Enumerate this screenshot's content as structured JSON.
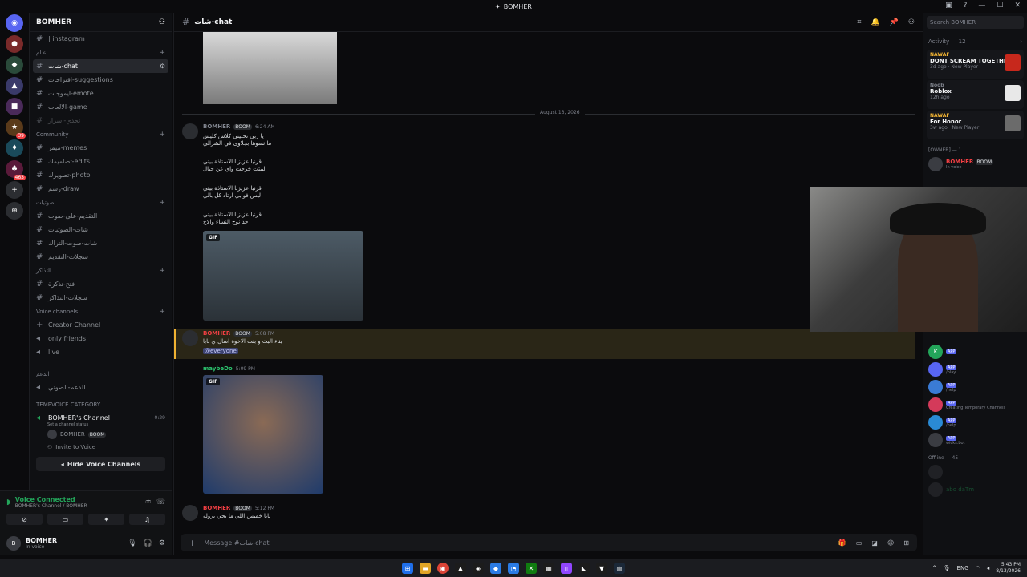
{
  "window": {
    "title": "BOMHER"
  },
  "servers": [
    {
      "icon": "discord-icon",
      "badge": ""
    },
    {
      "icon": "server-icon",
      "badge": ""
    },
    {
      "icon": "server-icon",
      "badge": ""
    },
    {
      "icon": "server-icon",
      "badge": ""
    },
    {
      "icon": "server-icon",
      "badge": ""
    },
    {
      "icon": "server-icon",
      "badge": "39"
    },
    {
      "icon": "server-icon",
      "badge": ""
    },
    {
      "icon": "server-icon",
      "badge": "463"
    }
  ],
  "server": {
    "name": "BOMHER"
  },
  "channels": {
    "instagram": "| instagram",
    "cat_general": "عـام",
    "chat": "شات-chat",
    "suggestions": "اقتراحات-suggestions",
    "emote": "ايموجات-emote",
    "game": "الالعاب-game",
    "hidden1": "تحدي-اسرار",
    "cat_community": "Community",
    "memes": "ميمز-memes",
    "edits": "تصاميمك-edits",
    "photo": "تصويرك-photo",
    "draw": "رسم-draw",
    "cat_voice_ar": "صوتيات",
    "v_ar1": "التقديم-على-صوت",
    "v_ar2": "شات-الصوتيات",
    "v_ar3": "شات-صوت-التراك",
    "v_ar4": "سجلات-التقديم",
    "cat_tickets": "التذاكر",
    "t1": "فتح-تذكرة",
    "t2": "سجلات-التذاكر",
    "cat_voice": "Voice channels",
    "creator": "Creator Channel",
    "only_friends": "only friends",
    "live": "live",
    "cat_support": "الدعم",
    "support_voice": "الدعم-الصوتي",
    "cat_temp": "TEMPVOICE CATEGORY",
    "bomher_channel": "BOMHER's Channel",
    "bomher_channel_time": "0:29",
    "channel_status": "Set a channel status",
    "voice_user": "BOMHER",
    "voice_user_tag": "BOOM",
    "invite": "Invite to Voice",
    "hide_btn": "Hide Voice Channels"
  },
  "voice": {
    "status": "Voice Connected",
    "location": "BOMHER's Channel / BOMHER"
  },
  "user": {
    "name": "BOMHER",
    "status": "In voice"
  },
  "chat": {
    "channel": "شات-chat",
    "date_divider": "August 13, 2026",
    "msg1": {
      "author": "BOMHER",
      "tag": "BOOM",
      "time": "6:24 AM",
      "lines": [
        "يا ربي تخليني كلاش كليش",
        "ما نسوها بجلاوى في الشرالي",
        "قرنيا عزيزنا الاستاذة بيتي",
        "ليبتت خرحت واي عن جبال",
        "قرنيا عزيزنا الاستاذة بيتي",
        "ليس فوابي ارتاد كل بالي",
        "قرنيا عزيزنا الاستاذة بيتي",
        "جذ نوح النساء والاخ"
      ]
    },
    "gif_label": "GIF",
    "msg2": {
      "author": "BOMHER",
      "tag": "BOOM",
      "time": "5:08 PM",
      "text": "بناء البث و بنت الاخوة اسال ي بابا",
      "mention": "@everyone"
    },
    "msg3": {
      "author": "maybeDo",
      "time": "5:09 PM"
    },
    "msg4": {
      "author": "BOMHER",
      "tag": "BOOM",
      "time": "5:12 PM",
      "text": "بابا خميس اللي ما يجي يروله"
    },
    "input_placeholder": "Message #شات-chat"
  },
  "members": {
    "search_placeholder": "Search BOMHER",
    "activity_title": "Activity — 12",
    "activities": [
      {
        "who": "NAWAF",
        "game": "DONT SCREAM TOGETHER",
        "meta": "3d ago · New Player",
        "color": "#c7281c"
      },
      {
        "who": "Noob",
        "game": "Roblox",
        "meta": "12h ago",
        "color": "#e8e8e8"
      },
      {
        "who": "NAWAF",
        "game": "For Honor",
        "meta": "3w ago · New Player",
        "color": "#6b6b6b"
      }
    ],
    "owner_role": "[OWNER] — 1",
    "owner": {
      "name": "BOMHER",
      "tag": "BOOM",
      "status": "In voice"
    },
    "bots": [
      {
        "sub": "",
        "app": "APP"
      },
      {
        "sub": "/play",
        "app": "APP"
      },
      {
        "sub": "/help",
        "app": "APP"
      },
      {
        "sub": "Creating Temporary Channels",
        "app": "APP"
      },
      {
        "sub": "/help",
        "app": "APP"
      },
      {
        "sub": "wicks.bot",
        "app": "APP"
      }
    ],
    "offline_role": "Offline — 45",
    "offline_member": "abo daTm"
  },
  "taskbar": {
    "time": "5:43 PM",
    "date": "8/13/2026",
    "lang": "ENG"
  }
}
